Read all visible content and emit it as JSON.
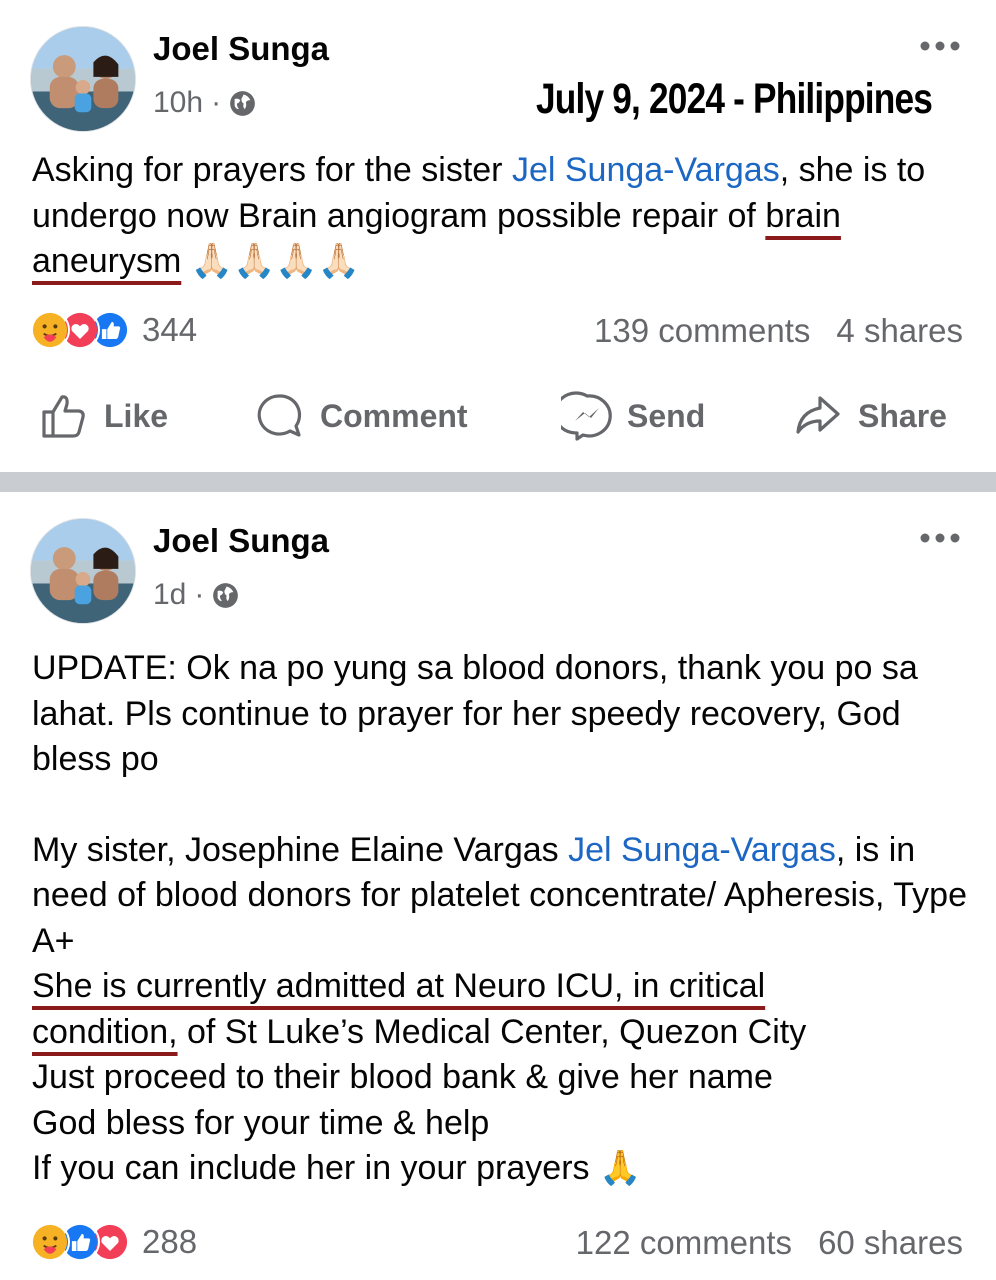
{
  "overlay": {
    "date_location": "July 9, 2024 - Philippines"
  },
  "posts": [
    {
      "author": "Joel Sunga",
      "time": "10h",
      "separator": "·",
      "body": {
        "t1": "Asking for prayers for the sister ",
        "mention": "Jel Sunga-Vargas",
        "t2": ", she is to undergo now Brain angiogram possible repair of ",
        "highlight": "brain aneurysm",
        "t3": " 🙏🏻🙏🏻🙏🏻🙏🏻"
      },
      "reaction_count": "344",
      "comments": "139 comments",
      "shares": "4 shares",
      "reactions": [
        "care",
        "love",
        "like"
      ]
    },
    {
      "author": "Joel Sunga",
      "time": "1d",
      "separator": "·",
      "body": {
        "p1": "UPDATE: Ok na po yung sa blood donors, thank you po sa lahat. Pls continue to prayer for her speedy recovery, God bless po",
        "p2a": "My sister, Josephine Elaine Vargas ",
        "mention": "Jel Sunga-Vargas",
        "p2b": ", is in need of blood donors for platelet concentrate/ Apheresis, Type A+",
        "highlight_a": "She is currently admitted at Neuro ICU, in critical",
        "highlight_b": "condition,",
        "p3": " of St Luke’s Medical Center, Quezon City",
        "l4": "Just proceed to their blood bank & give her name",
        "l5": "God bless for your time & help",
        "l6": "If you can include her in your prayers 🙏"
      },
      "reaction_count": "288",
      "comments": "122 comments",
      "shares": "60 shares",
      "reactions": [
        "care",
        "like",
        "love"
      ]
    }
  ],
  "actions": {
    "like": "Like",
    "comment": "Comment",
    "send": "Send",
    "share": "Share"
  },
  "colors": {
    "link": "#1d67c4",
    "meta": "#65676b",
    "underline": "#8b1a1a",
    "like_blue": "#1877f2",
    "love_red": "#f33e58",
    "care_yellow": "#f7b125"
  }
}
